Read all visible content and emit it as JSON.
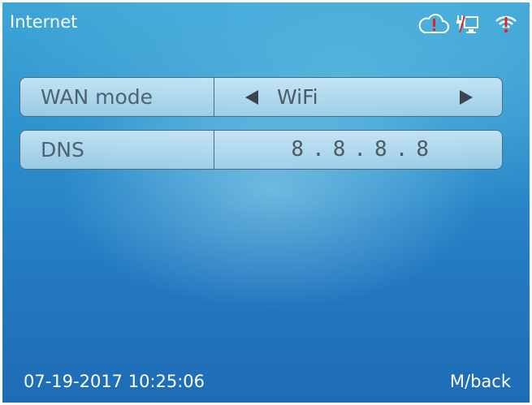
{
  "header": {
    "title": "Internet",
    "icons": [
      "cloud-alert-icon",
      "ethernet-disconnected-icon",
      "wifi-alert-icon"
    ],
    "alert_color": "#e0242a"
  },
  "settings": {
    "wan_mode": {
      "label": "WAN mode",
      "value": "WiFi"
    },
    "dns": {
      "label": "DNS",
      "value": "8.8.8.8"
    }
  },
  "footer": {
    "datetime": "07-19-2017 10:25:06",
    "back_label": "M/back"
  }
}
